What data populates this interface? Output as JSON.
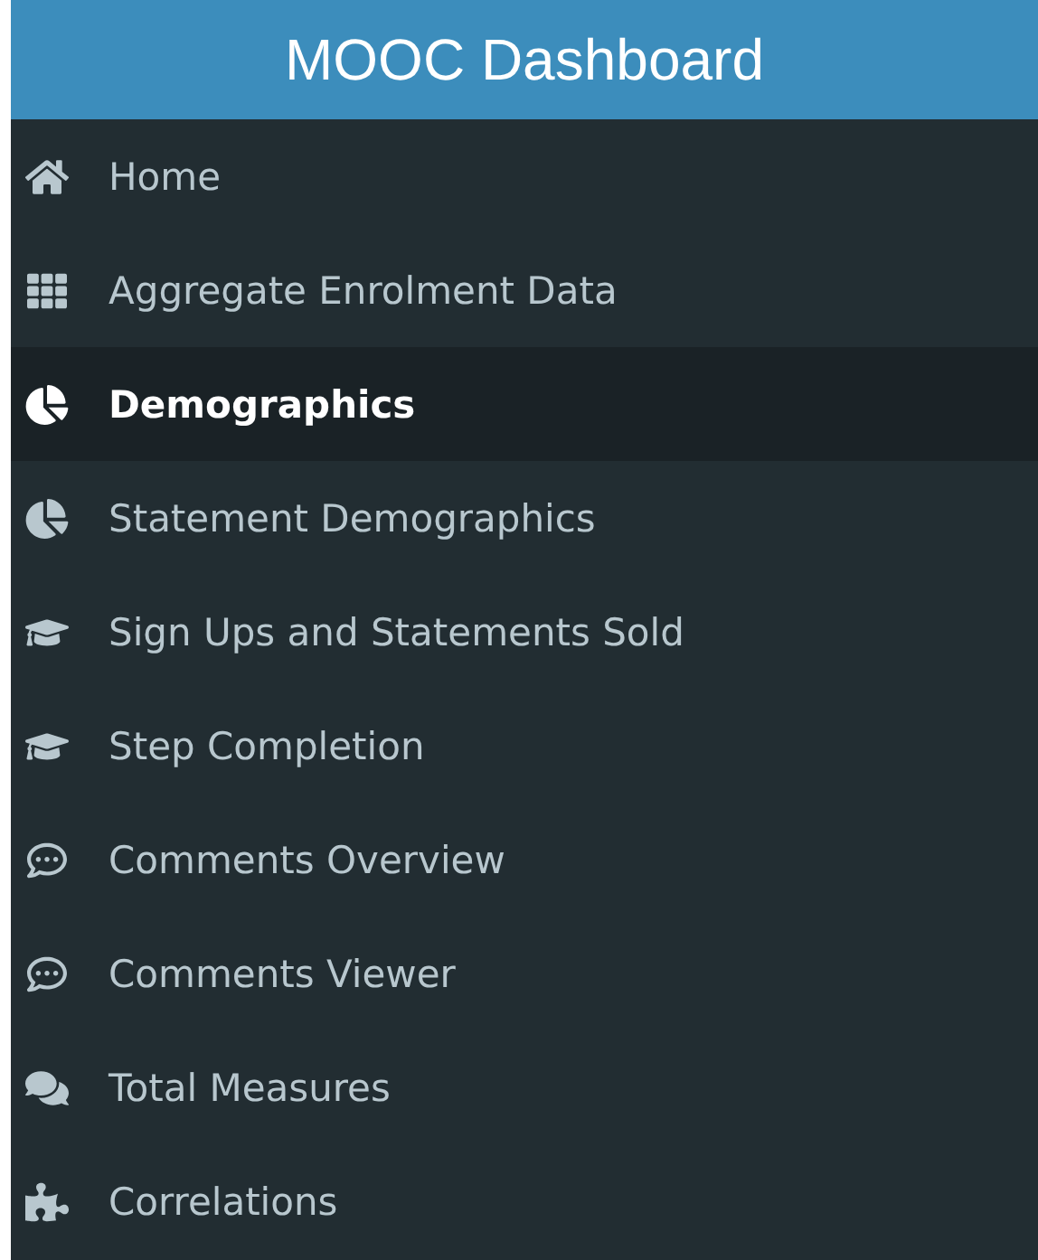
{
  "header": {
    "title": "MOOC Dashboard"
  },
  "sidebar": {
    "items": [
      {
        "label": "Home",
        "selected": false
      },
      {
        "label": "Aggregate Enrolment Data",
        "selected": false
      },
      {
        "label": "Demographics",
        "selected": true
      },
      {
        "label": "Statement Demographics",
        "selected": false
      },
      {
        "label": "Sign Ups and Statements Sold",
        "selected": false
      },
      {
        "label": "Step Completion",
        "selected": false
      },
      {
        "label": "Comments Overview",
        "selected": false
      },
      {
        "label": "Comments Viewer",
        "selected": false
      },
      {
        "label": "Total Measures",
        "selected": false
      },
      {
        "label": "Correlations",
        "selected": false
      }
    ]
  }
}
